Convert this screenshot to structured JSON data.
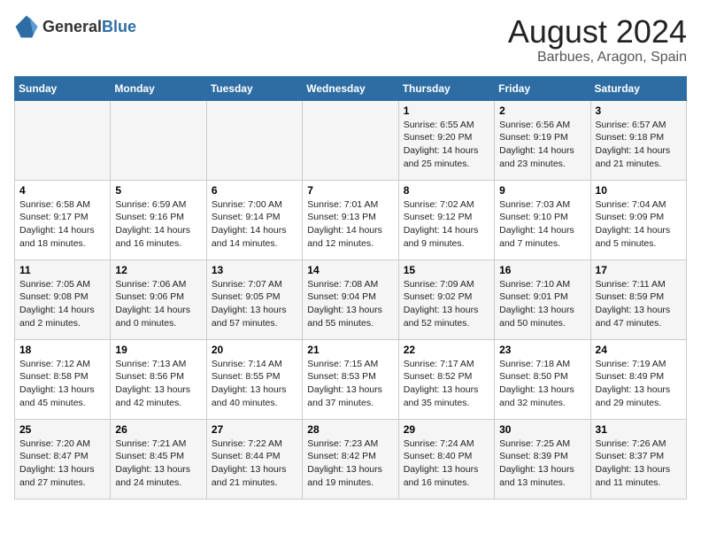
{
  "header": {
    "logo_general": "General",
    "logo_blue": "Blue",
    "title": "August 2024",
    "subtitle": "Barbues, Aragon, Spain"
  },
  "days_of_week": [
    "Sunday",
    "Monday",
    "Tuesday",
    "Wednesday",
    "Thursday",
    "Friday",
    "Saturday"
  ],
  "weeks": [
    {
      "days": [
        {
          "number": "",
          "info": ""
        },
        {
          "number": "",
          "info": ""
        },
        {
          "number": "",
          "info": ""
        },
        {
          "number": "",
          "info": ""
        },
        {
          "number": "1",
          "info": "Sunrise: 6:55 AM\nSunset: 9:20 PM\nDaylight: 14 hours\nand 25 minutes."
        },
        {
          "number": "2",
          "info": "Sunrise: 6:56 AM\nSunset: 9:19 PM\nDaylight: 14 hours\nand 23 minutes."
        },
        {
          "number": "3",
          "info": "Sunrise: 6:57 AM\nSunset: 9:18 PM\nDaylight: 14 hours\nand 21 minutes."
        }
      ]
    },
    {
      "days": [
        {
          "number": "4",
          "info": "Sunrise: 6:58 AM\nSunset: 9:17 PM\nDaylight: 14 hours\nand 18 minutes."
        },
        {
          "number": "5",
          "info": "Sunrise: 6:59 AM\nSunset: 9:16 PM\nDaylight: 14 hours\nand 16 minutes."
        },
        {
          "number": "6",
          "info": "Sunrise: 7:00 AM\nSunset: 9:14 PM\nDaylight: 14 hours\nand 14 minutes."
        },
        {
          "number": "7",
          "info": "Sunrise: 7:01 AM\nSunset: 9:13 PM\nDaylight: 14 hours\nand 12 minutes."
        },
        {
          "number": "8",
          "info": "Sunrise: 7:02 AM\nSunset: 9:12 PM\nDaylight: 14 hours\nand 9 minutes."
        },
        {
          "number": "9",
          "info": "Sunrise: 7:03 AM\nSunset: 9:10 PM\nDaylight: 14 hours\nand 7 minutes."
        },
        {
          "number": "10",
          "info": "Sunrise: 7:04 AM\nSunset: 9:09 PM\nDaylight: 14 hours\nand 5 minutes."
        }
      ]
    },
    {
      "days": [
        {
          "number": "11",
          "info": "Sunrise: 7:05 AM\nSunset: 9:08 PM\nDaylight: 14 hours\nand 2 minutes."
        },
        {
          "number": "12",
          "info": "Sunrise: 7:06 AM\nSunset: 9:06 PM\nDaylight: 14 hours\nand 0 minutes."
        },
        {
          "number": "13",
          "info": "Sunrise: 7:07 AM\nSunset: 9:05 PM\nDaylight: 13 hours\nand 57 minutes."
        },
        {
          "number": "14",
          "info": "Sunrise: 7:08 AM\nSunset: 9:04 PM\nDaylight: 13 hours\nand 55 minutes."
        },
        {
          "number": "15",
          "info": "Sunrise: 7:09 AM\nSunset: 9:02 PM\nDaylight: 13 hours\nand 52 minutes."
        },
        {
          "number": "16",
          "info": "Sunrise: 7:10 AM\nSunset: 9:01 PM\nDaylight: 13 hours\nand 50 minutes."
        },
        {
          "number": "17",
          "info": "Sunrise: 7:11 AM\nSunset: 8:59 PM\nDaylight: 13 hours\nand 47 minutes."
        }
      ]
    },
    {
      "days": [
        {
          "number": "18",
          "info": "Sunrise: 7:12 AM\nSunset: 8:58 PM\nDaylight: 13 hours\nand 45 minutes."
        },
        {
          "number": "19",
          "info": "Sunrise: 7:13 AM\nSunset: 8:56 PM\nDaylight: 13 hours\nand 42 minutes."
        },
        {
          "number": "20",
          "info": "Sunrise: 7:14 AM\nSunset: 8:55 PM\nDaylight: 13 hours\nand 40 minutes."
        },
        {
          "number": "21",
          "info": "Sunrise: 7:15 AM\nSunset: 8:53 PM\nDaylight: 13 hours\nand 37 minutes."
        },
        {
          "number": "22",
          "info": "Sunrise: 7:17 AM\nSunset: 8:52 PM\nDaylight: 13 hours\nand 35 minutes."
        },
        {
          "number": "23",
          "info": "Sunrise: 7:18 AM\nSunset: 8:50 PM\nDaylight: 13 hours\nand 32 minutes."
        },
        {
          "number": "24",
          "info": "Sunrise: 7:19 AM\nSunset: 8:49 PM\nDaylight: 13 hours\nand 29 minutes."
        }
      ]
    },
    {
      "days": [
        {
          "number": "25",
          "info": "Sunrise: 7:20 AM\nSunset: 8:47 PM\nDaylight: 13 hours\nand 27 minutes."
        },
        {
          "number": "26",
          "info": "Sunrise: 7:21 AM\nSunset: 8:45 PM\nDaylight: 13 hours\nand 24 minutes."
        },
        {
          "number": "27",
          "info": "Sunrise: 7:22 AM\nSunset: 8:44 PM\nDaylight: 13 hours\nand 21 minutes."
        },
        {
          "number": "28",
          "info": "Sunrise: 7:23 AM\nSunset: 8:42 PM\nDaylight: 13 hours\nand 19 minutes."
        },
        {
          "number": "29",
          "info": "Sunrise: 7:24 AM\nSunset: 8:40 PM\nDaylight: 13 hours\nand 16 minutes."
        },
        {
          "number": "30",
          "info": "Sunrise: 7:25 AM\nSunset: 8:39 PM\nDaylight: 13 hours\nand 13 minutes."
        },
        {
          "number": "31",
          "info": "Sunrise: 7:26 AM\nSunset: 8:37 PM\nDaylight: 13 hours\nand 11 minutes."
        }
      ]
    }
  ]
}
